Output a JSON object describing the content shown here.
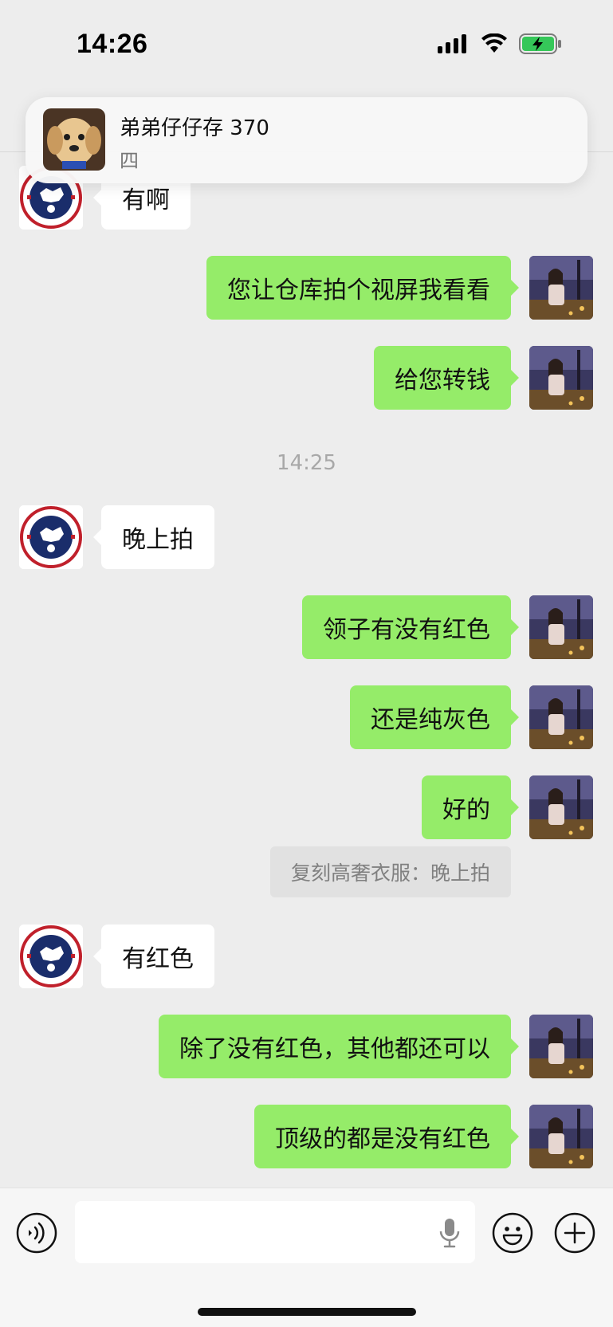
{
  "status_bar": {
    "time": "14:26"
  },
  "notification": {
    "sender": "弟弟仔仔存 370",
    "message": "四"
  },
  "messages": [
    {
      "side": "in",
      "text": "有啊"
    },
    {
      "side": "out",
      "text": "您让仓库拍个视屏我看看"
    },
    {
      "side": "out",
      "text": "给您转钱"
    },
    {
      "side": "out",
      "text": "领子有没有红色"
    },
    {
      "side": "in",
      "text": "晚上拍"
    },
    {
      "side": "out",
      "text": "还是纯灰色"
    },
    {
      "side": "out",
      "text": "好的"
    },
    {
      "side": "in",
      "text": "有红色"
    },
    {
      "side": "out",
      "text": "除了没有红色，其他都还可以"
    },
    {
      "side": "out",
      "text": "顶级的都是没有红色"
    }
  ],
  "timestamp": "14:25",
  "quote": "复刻高奢衣服：晚上拍",
  "colors": {
    "sent_bubble": "#95ec69",
    "received_bubble": "#ffffff",
    "background": "#ededed"
  },
  "icons": [
    "voice-icon",
    "microphone-icon",
    "emoji-icon",
    "plus-icon",
    "signal-icon",
    "wifi-icon",
    "battery-charging-icon"
  ]
}
